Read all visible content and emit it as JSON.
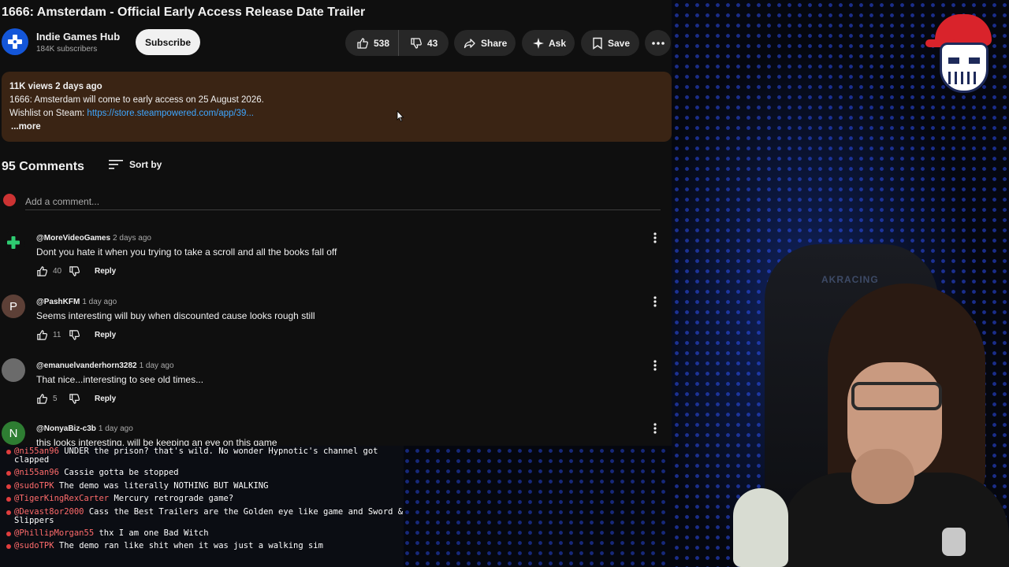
{
  "video": {
    "title": "1666: Amsterdam - Official Early Access Release Date Trailer",
    "channel_name": "Indie Games Hub",
    "subscribers": "184K subscribers",
    "subscribe_label": "Subscribe",
    "likes": "538",
    "dislikes": "43",
    "share_label": "Share",
    "ask_label": "Ask",
    "save_label": "Save"
  },
  "description": {
    "stats": "11K views  2 days ago",
    "line1": "1666: Amsterdam will come to early access on 25 August 2026.",
    "wishlist_prefix": "Wishlist on Steam: ",
    "link": "https://store.steampowered.com/app/39...",
    "more": "...more"
  },
  "comments_section": {
    "count_label": "95 Comments",
    "sort_label": "Sort by",
    "add_placeholder": "Add a comment...",
    "reply_label": "Reply",
    "items": [
      {
        "author": "@MoreVideoGames",
        "time": "2 days ago",
        "text": "Dont you hate it when you trying to take a scroll and all the books fall off",
        "likes": "40",
        "avatar_letter": "",
        "avatar_color": "#0f0f0f"
      },
      {
        "author": "@PashKFM",
        "time": "1 day ago",
        "text": "Seems interesting will buy when discounted cause looks rough still",
        "likes": "11",
        "avatar_letter": "P",
        "avatar_color": "#5d4037"
      },
      {
        "author": "@emanuelvanderhorn3282",
        "time": "1 day ago",
        "text": "That nice...interesting to see old times...",
        "likes": "5",
        "avatar_letter": "",
        "avatar_color": "#6b6b6b"
      },
      {
        "author": "@NonyaBiz-c3b",
        "time": "1 day ago",
        "text": "this looks interesting. will be keeping an eye on this game",
        "likes": "",
        "avatar_letter": "N",
        "avatar_color": "#2e7d32"
      }
    ]
  },
  "chat": [
    {
      "user": "@ni55an96",
      "text": "UNDER the prison? that's wild. No wonder Hypnotic's channel got clapped"
    },
    {
      "user": "@ni55an96",
      "text": "Cassie gotta be stopped"
    },
    {
      "user": "@sudoTPK",
      "text": "The demo was literally NOTHING BUT WALKING"
    },
    {
      "user": "@TigerKingRexCarter",
      "text": "Mercury retrograde game?"
    },
    {
      "user": "@Devast8or2000",
      "text": "Cass the Best Trailers are the Golden eye like game and Sword & Slippers"
    },
    {
      "user": "@PhillipMorgan55",
      "text": "thx I am one Bad Witch"
    },
    {
      "user": "@sudoTPK",
      "text": "The demo ran like shit when it was just a walking sim"
    }
  ],
  "overlay": {
    "chair_brand": "AKRACING"
  },
  "colors": {
    "background": "#0f0f0f",
    "description_bg": "#3a2414",
    "link": "#3ea6ff",
    "chat_user": "#ff6b6b"
  }
}
